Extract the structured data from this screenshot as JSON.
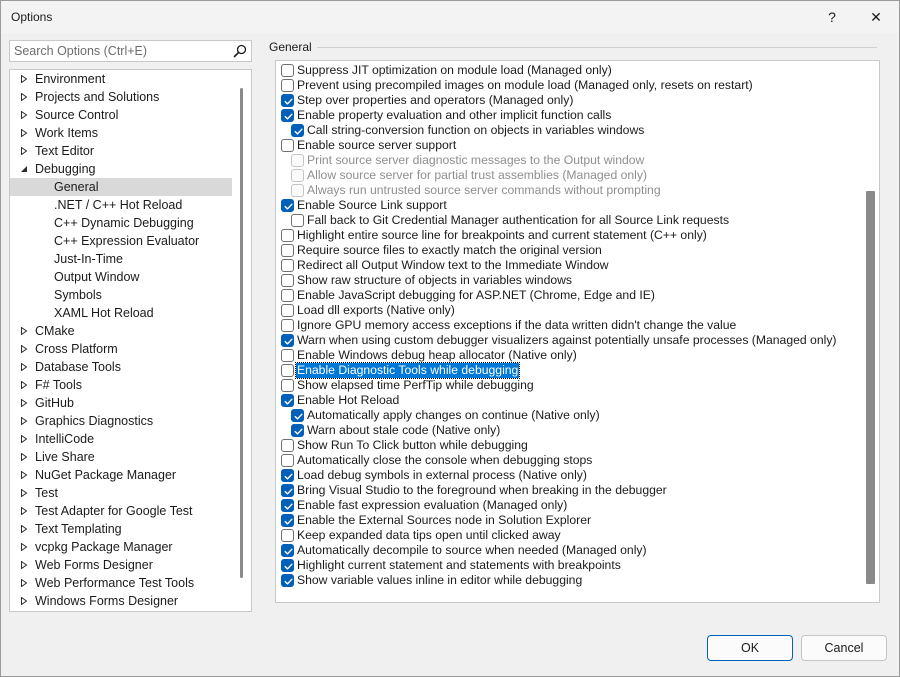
{
  "window": {
    "title": "Options",
    "help_label": "?",
    "close_label": "✕"
  },
  "search": {
    "placeholder": "Search Options (Ctrl+E)"
  },
  "tree": {
    "items": [
      {
        "label": "Environment",
        "level": 0,
        "expander": "collapsed"
      },
      {
        "label": "Projects and Solutions",
        "level": 0,
        "expander": "collapsed"
      },
      {
        "label": "Source Control",
        "level": 0,
        "expander": "collapsed"
      },
      {
        "label": "Work Items",
        "level": 0,
        "expander": "collapsed"
      },
      {
        "label": "Text Editor",
        "level": 0,
        "expander": "collapsed"
      },
      {
        "label": "Debugging",
        "level": 0,
        "expander": "expanded"
      },
      {
        "label": "General",
        "level": 1,
        "expander": "none",
        "selected": true
      },
      {
        "label": ".NET / C++ Hot Reload",
        "level": 1,
        "expander": "none"
      },
      {
        "label": "C++ Dynamic Debugging",
        "level": 1,
        "expander": "none"
      },
      {
        "label": "C++ Expression Evaluator",
        "level": 1,
        "expander": "none"
      },
      {
        "label": "Just-In-Time",
        "level": 1,
        "expander": "none"
      },
      {
        "label": "Output Window",
        "level": 1,
        "expander": "none"
      },
      {
        "label": "Symbols",
        "level": 1,
        "expander": "none"
      },
      {
        "label": "XAML Hot Reload",
        "level": 1,
        "expander": "none"
      },
      {
        "label": "CMake",
        "level": 0,
        "expander": "collapsed"
      },
      {
        "label": "Cross Platform",
        "level": 0,
        "expander": "collapsed"
      },
      {
        "label": "Database Tools",
        "level": 0,
        "expander": "collapsed"
      },
      {
        "label": "F# Tools",
        "level": 0,
        "expander": "collapsed"
      },
      {
        "label": "GitHub",
        "level": 0,
        "expander": "collapsed"
      },
      {
        "label": "Graphics Diagnostics",
        "level": 0,
        "expander": "collapsed"
      },
      {
        "label": "IntelliCode",
        "level": 0,
        "expander": "collapsed"
      },
      {
        "label": "Live Share",
        "level": 0,
        "expander": "collapsed"
      },
      {
        "label": "NuGet Package Manager",
        "level": 0,
        "expander": "collapsed"
      },
      {
        "label": "Test",
        "level": 0,
        "expander": "collapsed"
      },
      {
        "label": "Test Adapter for Google Test",
        "level": 0,
        "expander": "collapsed"
      },
      {
        "label": "Text Templating",
        "level": 0,
        "expander": "collapsed"
      },
      {
        "label": "vcpkg Package Manager",
        "level": 0,
        "expander": "collapsed"
      },
      {
        "label": "Web Forms Designer",
        "level": 0,
        "expander": "collapsed"
      },
      {
        "label": "Web Performance Test Tools",
        "level": 0,
        "expander": "collapsed"
      },
      {
        "label": "Windows Forms Designer",
        "level": 0,
        "expander": "collapsed"
      }
    ]
  },
  "general": {
    "group_label": "General",
    "options": [
      {
        "label": "Suppress JIT optimization on module load (Managed only)",
        "checked": false,
        "indent": 0
      },
      {
        "label": "Prevent using precompiled images on module load (Managed only, resets on restart)",
        "checked": false,
        "indent": 0
      },
      {
        "label": "Step over properties and operators (Managed only)",
        "checked": true,
        "indent": 0
      },
      {
        "label": "Enable property evaluation and other implicit function calls",
        "checked": true,
        "indent": 0
      },
      {
        "label": "Call string-conversion function on objects in variables windows",
        "checked": true,
        "indent": 1
      },
      {
        "label": "Enable source server support",
        "checked": false,
        "indent": 0
      },
      {
        "label": "Print source server diagnostic messages to the Output window",
        "checked": false,
        "indent": 1,
        "disabled": true
      },
      {
        "label": "Allow source server for partial trust assemblies (Managed only)",
        "checked": false,
        "indent": 1,
        "disabled": true
      },
      {
        "label": "Always run untrusted source server commands without prompting",
        "checked": false,
        "indent": 1,
        "disabled": true
      },
      {
        "label": "Enable Source Link support",
        "checked": true,
        "indent": 0
      },
      {
        "label": "Fall back to Git Credential Manager authentication for all Source Link requests",
        "checked": false,
        "indent": 1
      },
      {
        "label": "Highlight entire source line for breakpoints and current statement (C++ only)",
        "checked": false,
        "indent": 0
      },
      {
        "label": "Require source files to exactly match the original version",
        "checked": false,
        "indent": 0
      },
      {
        "label": "Redirect all Output Window text to the Immediate Window",
        "checked": false,
        "indent": 0
      },
      {
        "label": "Show raw structure of objects in variables windows",
        "checked": false,
        "indent": 0
      },
      {
        "label": "Enable JavaScript debugging for ASP.NET (Chrome, Edge and IE)",
        "checked": false,
        "indent": 0
      },
      {
        "label": "Load dll exports (Native only)",
        "checked": false,
        "indent": 0
      },
      {
        "label": "Ignore GPU memory access exceptions if the data written didn't change the value",
        "checked": false,
        "indent": 0
      },
      {
        "label": "Warn when using custom debugger visualizers against potentially unsafe processes (Managed only)",
        "checked": true,
        "indent": 0
      },
      {
        "label": "Enable Windows debug heap allocator (Native only)",
        "checked": false,
        "indent": 0
      },
      {
        "label": "Enable Diagnostic Tools while debugging",
        "checked": false,
        "indent": 0,
        "highlighted": true
      },
      {
        "label": "Show elapsed time PerfTip while debugging",
        "checked": false,
        "indent": 0
      },
      {
        "label": "Enable Hot Reload",
        "checked": true,
        "indent": 0
      },
      {
        "label": "Automatically apply changes on continue (Native only)",
        "checked": true,
        "indent": 1
      },
      {
        "label": "Warn about stale code (Native only)",
        "checked": true,
        "indent": 1
      },
      {
        "label": "Show Run To Click button while debugging",
        "checked": false,
        "indent": 0
      },
      {
        "label": "Automatically close the console when debugging stops",
        "checked": false,
        "indent": 0
      },
      {
        "label": "Load debug symbols in external process (Native only)",
        "checked": true,
        "indent": 0
      },
      {
        "label": "Bring Visual Studio to the foreground when breaking in the debugger",
        "checked": true,
        "indent": 0
      },
      {
        "label": "Enable fast expression evaluation (Managed only)",
        "checked": true,
        "indent": 0
      },
      {
        "label": "Enable the External Sources node in Solution Explorer",
        "checked": true,
        "indent": 0
      },
      {
        "label": "Keep expanded data tips open until clicked away",
        "checked": false,
        "indent": 0
      },
      {
        "label": "Automatically decompile to source when needed (Managed only)",
        "checked": true,
        "indent": 0
      },
      {
        "label": "Highlight current statement and statements with breakpoints",
        "checked": true,
        "indent": 0
      },
      {
        "label": "Show variable values inline in editor while debugging",
        "checked": true,
        "indent": 0
      }
    ]
  },
  "buttons": {
    "ok_label": "OK",
    "cancel_label": "Cancel"
  },
  "colors": {
    "accent": "#005fb8",
    "selection": "#0078d7",
    "tree_selected": "#d9d9d9"
  }
}
